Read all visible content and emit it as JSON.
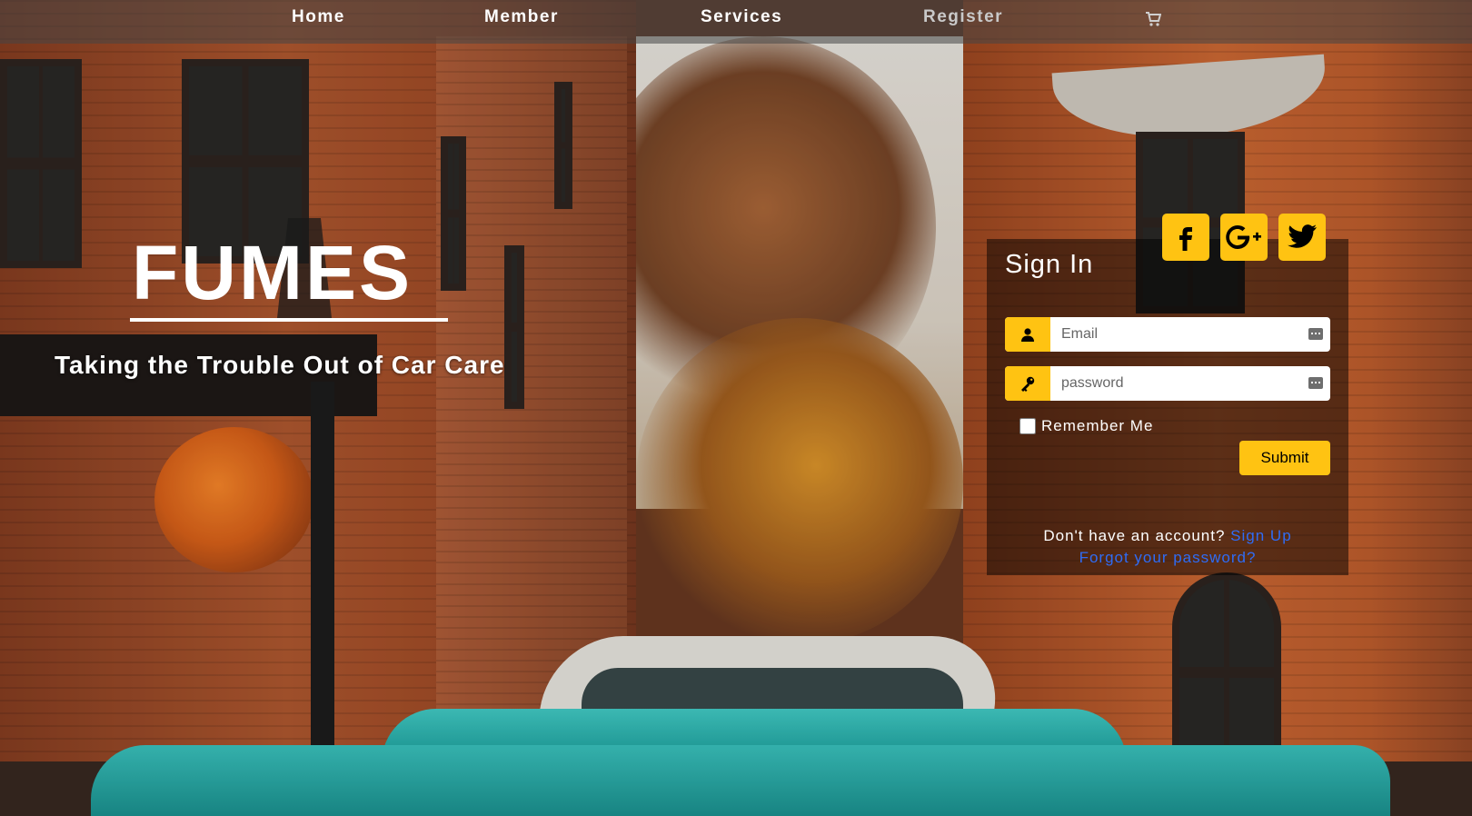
{
  "nav": {
    "items": [
      "Home",
      "Member",
      "Services",
      "Register"
    ],
    "cart_icon": "cart-icon"
  },
  "hero": {
    "brand": "FUMES",
    "tagline": "Taking the Trouble Out of Car Care"
  },
  "signin": {
    "title": "Sign In",
    "social": [
      "facebook-icon",
      "google-plus-icon",
      "twitter-icon"
    ],
    "email_placeholder": "Email",
    "password_placeholder": "password",
    "remember_label": "Remember Me",
    "remember_checked": false,
    "submit_label": "Submit",
    "no_account_text": "Don't have an account?",
    "signup_link": "Sign Up",
    "forgot_link": "Forgot your password?"
  },
  "colors": {
    "accent": "#ffc312",
    "link": "#2f6cf5",
    "card_bg": "rgba(0,0,0,0.5)"
  }
}
